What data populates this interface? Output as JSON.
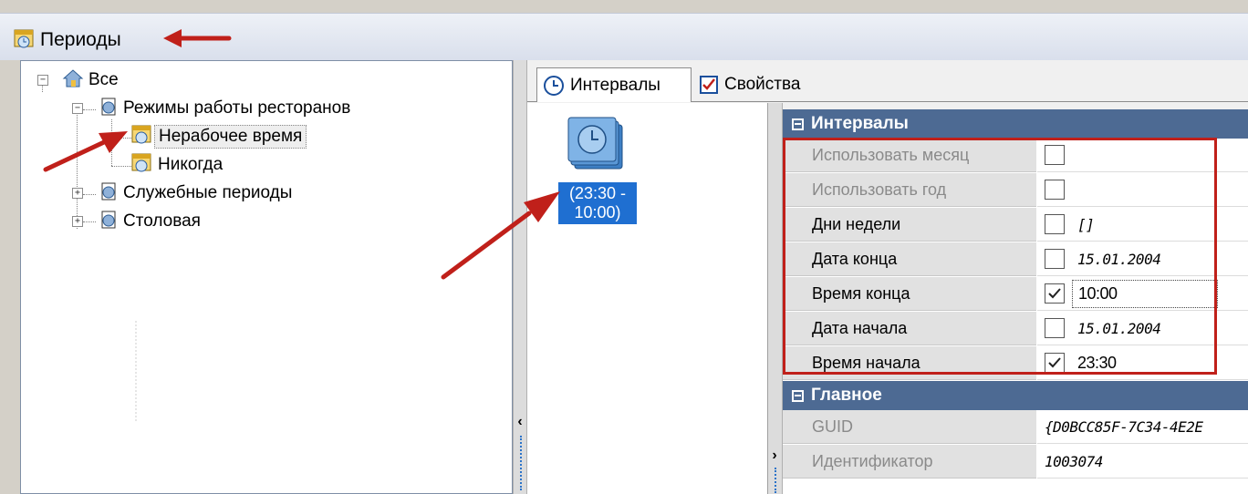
{
  "window": {
    "title": "Периоды",
    "title_icon": "calendar-clock-icon"
  },
  "tree": {
    "root": {
      "label": "Все",
      "icon": "house-icon"
    },
    "nodes": [
      {
        "label": "Режимы работы ресторанов",
        "icon": "folder-clock-icon"
      },
      {
        "label": "Нерабочее время",
        "icon": "calendar-clock-icon",
        "selected": true
      },
      {
        "label": "Никогда",
        "icon": "calendar-clock-icon"
      },
      {
        "label": "Служебные периоды",
        "icon": "folder-clock-icon"
      },
      {
        "label": "Столовая",
        "icon": "folder-clock-icon"
      }
    ]
  },
  "tabs": [
    {
      "label": "Интервалы",
      "icon": "clock-icon",
      "active": true
    },
    {
      "label": "Свойства",
      "icon": "properties-icon",
      "active": false
    }
  ],
  "interval_list": {
    "items": [
      {
        "line1": "(23:30 -",
        "line2": "10:00)",
        "icon": "clock-tile-icon",
        "selected": true
      }
    ]
  },
  "property_grid": {
    "categories": [
      {
        "title": "Интервалы",
        "rows": [
          {
            "name": "Использовать месяц",
            "checked": false,
            "value": "",
            "disabled": true
          },
          {
            "name": "Использовать год",
            "checked": false,
            "value": "",
            "disabled": true
          },
          {
            "name": "Дни недели",
            "checked": false,
            "value": "[]"
          },
          {
            "name": "Дата конца",
            "checked": false,
            "value": "15.01.2004"
          },
          {
            "name": "Время конца",
            "checked": true,
            "value": "10:00"
          },
          {
            "name": "Дата начала",
            "checked": false,
            "value": "15.01.2004"
          },
          {
            "name": "Время начала",
            "checked": true,
            "value": "23:30"
          }
        ]
      },
      {
        "title": "Главное",
        "rows": [
          {
            "name": "GUID",
            "value": "{D0BCC85F-7C34-4E2E"
          },
          {
            "name": "Идентификатор",
            "value": "1003074"
          }
        ]
      }
    ]
  },
  "colors": {
    "category_header": "#4d6a93",
    "selection": "#1f6fd1",
    "annotation": "#c0201a"
  }
}
